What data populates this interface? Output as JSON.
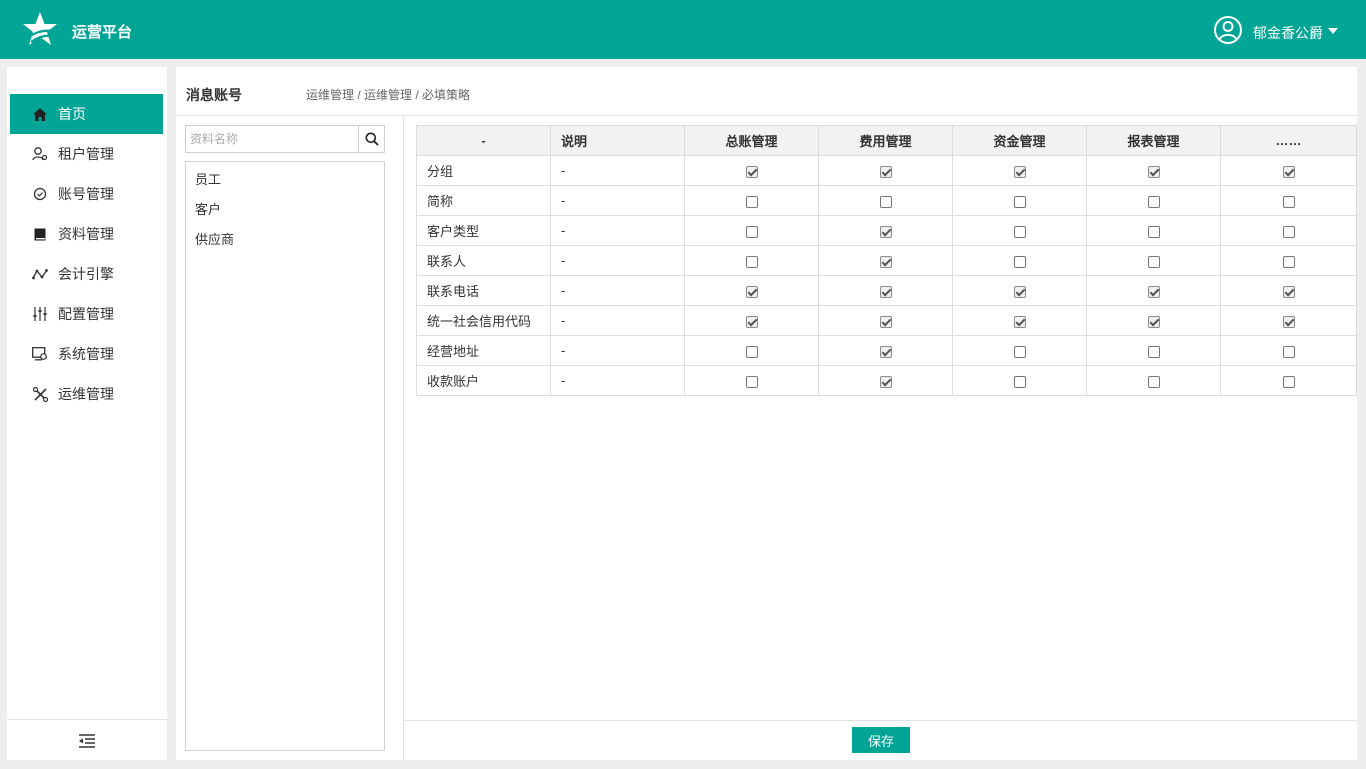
{
  "header": {
    "app_title": "运营平台",
    "user_name": "郁金香公爵",
    "logo_icon": "star-logo-icon",
    "user_icon": "user-circle-icon",
    "accent_color": "#00a596"
  },
  "sidebar": {
    "items": [
      {
        "label": "首页",
        "icon": "home-icon",
        "active": true
      },
      {
        "label": "租户管理",
        "icon": "tenant-icon"
      },
      {
        "label": "账号管理",
        "icon": "account-icon"
      },
      {
        "label": "资料管理",
        "icon": "book-icon"
      },
      {
        "label": "会计引擎",
        "icon": "engine-icon"
      },
      {
        "label": "配置管理",
        "icon": "sliders-icon"
      },
      {
        "label": "系统管理",
        "icon": "system-icon"
      },
      {
        "label": "运维管理",
        "icon": "tools-icon"
      }
    ],
    "collapse_icon": "collapse-menu-icon"
  },
  "page": {
    "title": "消息账号",
    "breadcrumb": "运维管理 / 运维管理 / 必填策略"
  },
  "search": {
    "placeholder": "资料名称",
    "value": ""
  },
  "list": {
    "items": [
      "员工",
      "客户",
      "供应商"
    ]
  },
  "table": {
    "headers": [
      "-",
      "说明",
      "总账管理",
      "费用管理",
      "资金管理",
      "报表管理",
      "……"
    ],
    "rows": [
      {
        "label": "分组",
        "desc": "-",
        "checks": [
          true,
          true,
          true,
          true,
          true
        ]
      },
      {
        "label": "简称",
        "desc": "-",
        "checks": [
          false,
          false,
          false,
          false,
          false
        ]
      },
      {
        "label": "客户类型",
        "desc": "-",
        "checks": [
          false,
          true,
          false,
          false,
          false
        ]
      },
      {
        "label": "联系人",
        "desc": "-",
        "checks": [
          false,
          true,
          false,
          false,
          false
        ]
      },
      {
        "label": "联系电话",
        "desc": "-",
        "checks": [
          true,
          true,
          true,
          true,
          true
        ]
      },
      {
        "label": "统一社会信用代码",
        "desc": "-",
        "checks": [
          true,
          true,
          true,
          true,
          true
        ]
      },
      {
        "label": "经营地址",
        "desc": "-",
        "checks": [
          false,
          true,
          false,
          false,
          false
        ]
      },
      {
        "label": "收款账户",
        "desc": "-",
        "checks": [
          false,
          true,
          false,
          false,
          false
        ]
      }
    ]
  },
  "actions": {
    "save_label": "保存"
  }
}
